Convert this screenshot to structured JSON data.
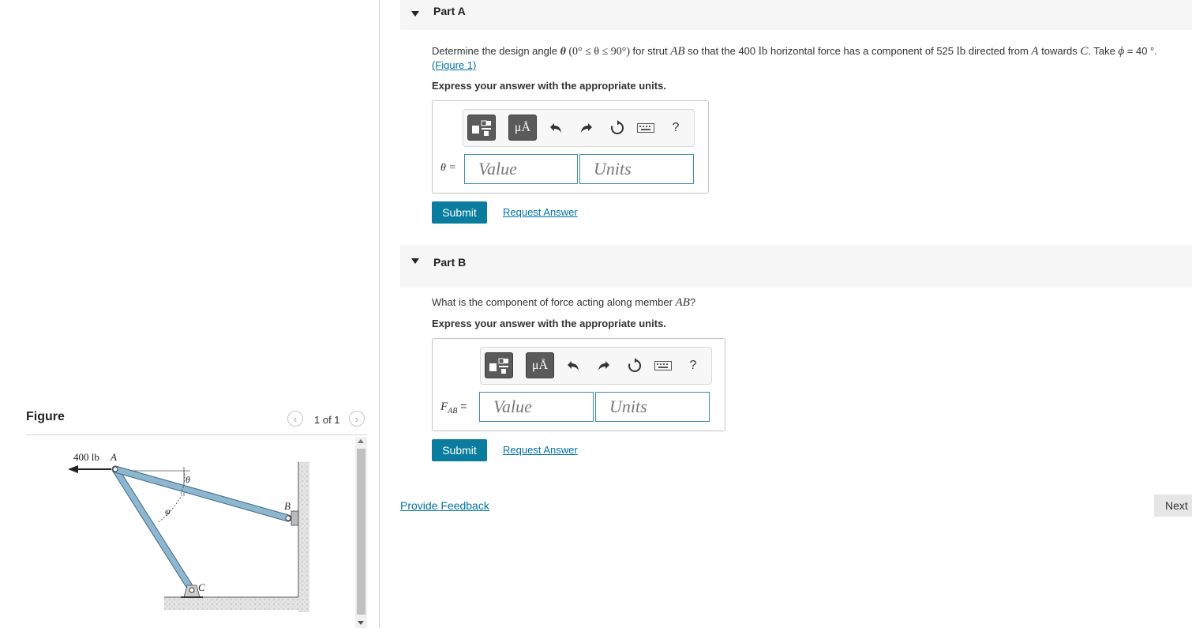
{
  "figure_panel": {
    "title": "Figure",
    "counter": "1 of 1",
    "diagram_labels": {
      "force": "400 lb",
      "point_a": "A",
      "point_b": "B",
      "point_c": "C",
      "theta": "θ",
      "phi": "φ"
    }
  },
  "part_a": {
    "header": "Part A",
    "question_pre": "Determine the design angle ",
    "question_theta": "θ",
    "question_range": " (0° ≤ θ ≤ 90°) ",
    "question_mid1": "for strut ",
    "question_ab": "AB",
    "question_mid2": " so that the 400 ",
    "question_lb1": "lb",
    "question_mid3": " horizontal force has a component of 525 ",
    "question_lb2": "lb",
    "question_mid4": " directed from ",
    "question_a": "A",
    "question_mid5": " towards ",
    "question_c": "C",
    "question_mid6": ". Take ",
    "question_phi": "ϕ",
    "question_end": " = 40 °.",
    "figure_link": "(Figure 1)",
    "instructions": "Express your answer with the appropriate units.",
    "var_label": "θ =",
    "value_placeholder": "Value",
    "units_placeholder": "Units",
    "submit": "Submit",
    "request": "Request Answer"
  },
  "part_b": {
    "header": "Part B",
    "question_pre": "What is the component of force acting along member ",
    "question_ab": "AB",
    "question_end": "?",
    "instructions": "Express your answer with the appropriate units.",
    "var_main": "F",
    "var_sub": "AB",
    "var_eq": " =",
    "value_placeholder": "Value",
    "units_placeholder": "Units",
    "submit": "Submit",
    "request": "Request Answer"
  },
  "toolbar": {
    "units_symbol": "μÅ",
    "help": "?"
  },
  "footer": {
    "feedback": "Provide Feedback",
    "next": "Next"
  },
  "colors": {
    "accent": "#0a7d9e",
    "link": "#0072a3",
    "strut": "#8fb6cf"
  }
}
